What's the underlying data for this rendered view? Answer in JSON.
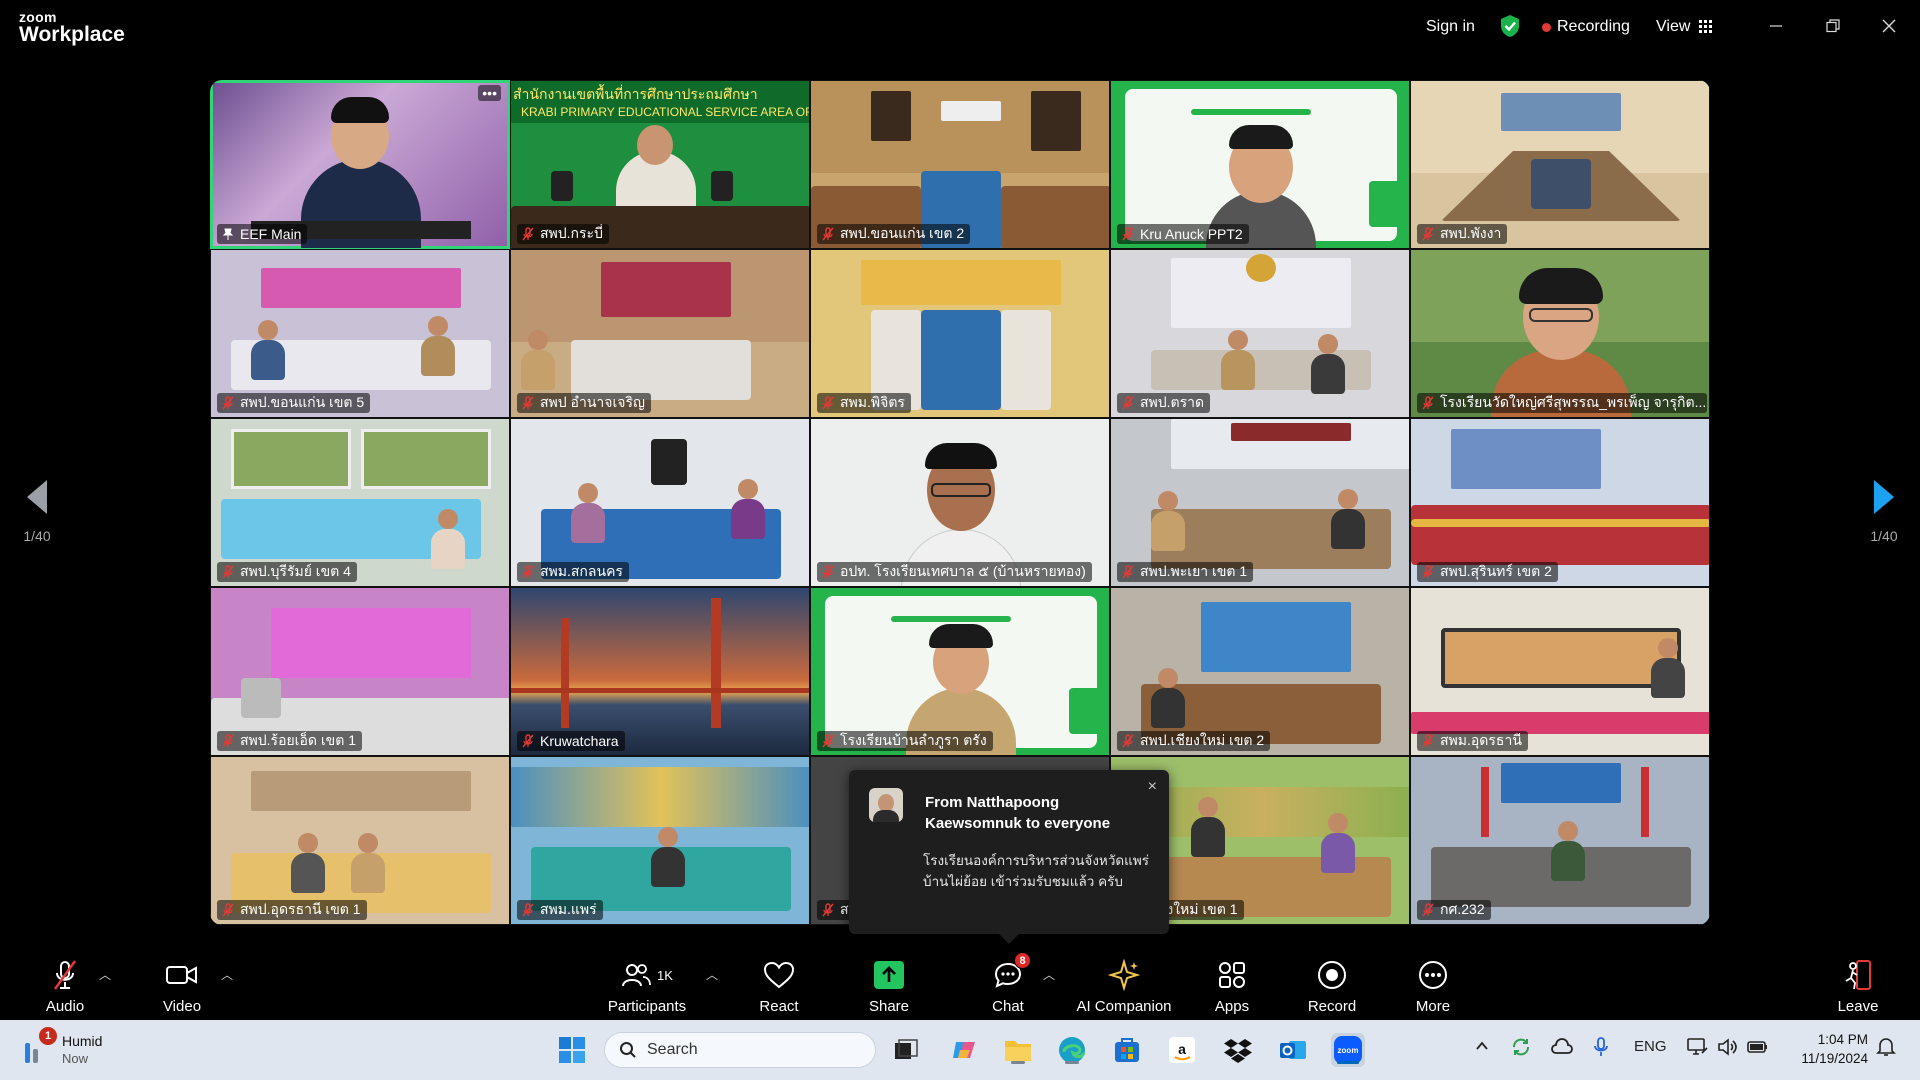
{
  "app": {
    "logo_top": "zoom",
    "logo_bottom": "Workplace"
  },
  "titlebar": {
    "sign_in": "Sign in",
    "recording": "Recording",
    "view": "View",
    "minimize": "—",
    "restore": "❐",
    "close": "✕"
  },
  "gallery": {
    "page_left": "1/40",
    "page_right": "1/40",
    "tiles": [
      {
        "name": "EEF Main",
        "active": true
      },
      {
        "name": "สพป.กระบี่"
      },
      {
        "name": "สพป.ขอนแก่น เขต 2"
      },
      {
        "name": "Kru Anuck PPT2"
      },
      {
        "name": "สพป.พังงา"
      },
      {
        "name": "สพป.ขอนแก่น เขต 5"
      },
      {
        "name": "สพป อำนาจเจริญ"
      },
      {
        "name": "สพม.พิจิตร"
      },
      {
        "name": "สพป.ตราด"
      },
      {
        "name": "โรงเรียนวัดใหญ่ศรีสุพรรณ_พรเพ็ญ จารุกิต..."
      },
      {
        "name": "สพป.บุรีรัมย์ เขต 4"
      },
      {
        "name": "สพม.สกลนคร"
      },
      {
        "name": "อปท. โรงเรียนเทศบาล ๕ (บ้านหรายทอง)"
      },
      {
        "name": "สพป.พะเยา เขต 1"
      },
      {
        "name": "สพป.สุรินทร์ เขต 2"
      },
      {
        "name": "สพป.ร้อยเอ็ด เขต 1"
      },
      {
        "name": "Kruwatchara"
      },
      {
        "name": "โรงเรียนบ้านลำภูรา ตรัง"
      },
      {
        "name": "สพป.เชียงใหม่ เขต 2"
      },
      {
        "name": "สพม.อุดรธานี"
      },
      {
        "name": "สพป.อุดรธานี เขต 1"
      },
      {
        "name": "สพม.แพร่"
      },
      {
        "name": "ส"
      },
      {
        "name": ".เชียงใหม่ เขต 1"
      },
      {
        "name": "กศ.232"
      }
    ],
    "banner_text_tile2": "สำนักงานเขตพื้นที่การศึกษาประถมศึกษา",
    "banner_text_tile2_en": "KRABI PRIMARY EDUCATIONAL SERVICE AREA OF"
  },
  "chat_popup": {
    "from": "From Natthapoong Kaewsomnuk to everyone",
    "message": "โรงเรียนองค์การบริหารส่วนจังหวัดแพร่ บ้านไผ่ย้อย เข้าร่วมรับชมแล้ว ครับ",
    "close": "×"
  },
  "toolbar": {
    "audio": "Audio",
    "video": "Video",
    "participants": "Participants",
    "participants_count": "1K",
    "react": "React",
    "share": "Share",
    "chat": "Chat",
    "chat_badge": "8",
    "ai_companion": "AI Companion",
    "apps": "Apps",
    "record": "Record",
    "more": "More",
    "leave": "Leave"
  },
  "taskbar": {
    "weather_label": "Humid",
    "weather_time": "Now",
    "weather_badge": "1",
    "search_placeholder": "Search",
    "lang": "ENG",
    "time": "1:04 PM",
    "date": "11/19/2024"
  },
  "colors": {
    "accent_green": "#2fd576",
    "share_green": "#22c55e",
    "nav_blue": "#1da1f2",
    "badge_red": "#e02828"
  }
}
